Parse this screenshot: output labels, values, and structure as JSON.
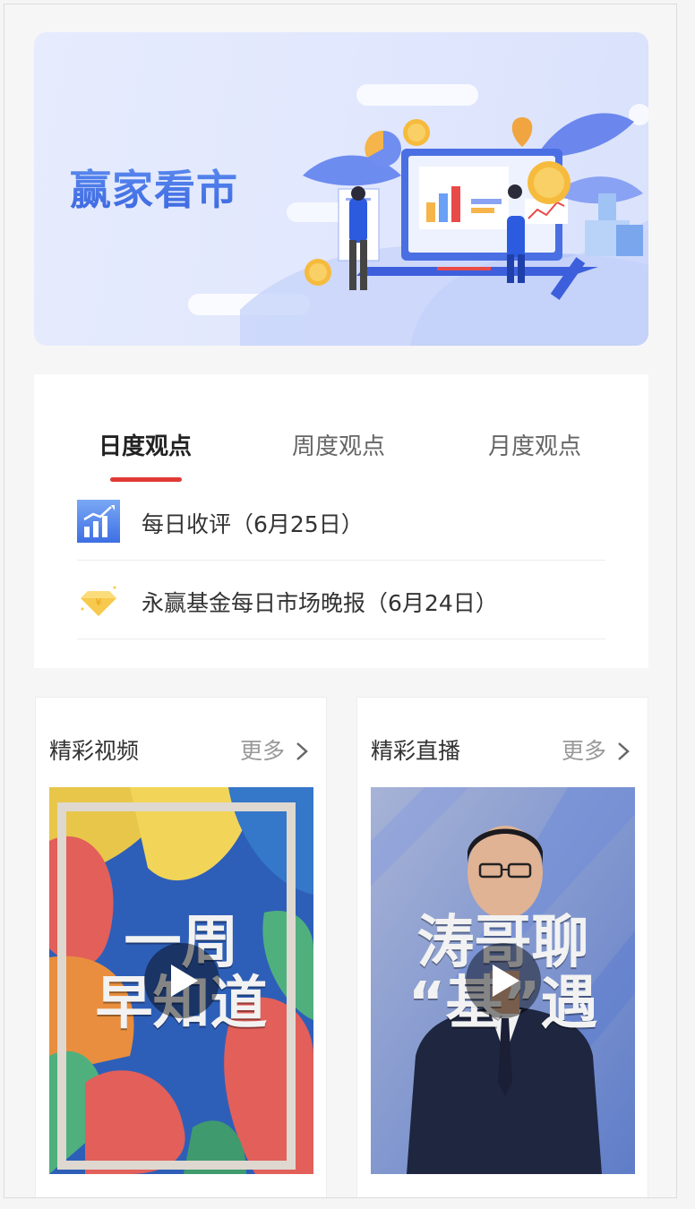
{
  "banner": {
    "title": "赢家看市"
  },
  "tabs": [
    {
      "label": "日度观点",
      "active": true
    },
    {
      "label": "周度观点",
      "active": false
    },
    {
      "label": "月度观点",
      "active": false
    }
  ],
  "list": [
    {
      "icon": "chart-icon",
      "text": "每日收评（6月25日）"
    },
    {
      "icon": "diamond-icon",
      "text": "永赢基金每日市场晚报（6月24日）"
    }
  ],
  "video_section": {
    "title": "精彩视频",
    "more": "更多",
    "thumb_line1": "一周",
    "thumb_line2": "早知道"
  },
  "live_section": {
    "title": "精彩直播",
    "more": "更多",
    "thumb_line1": "涛哥聊",
    "thumb_line2": "“基”遇"
  },
  "colors": {
    "accent": "#e13a35",
    "banner_title": "#4a78e8"
  }
}
